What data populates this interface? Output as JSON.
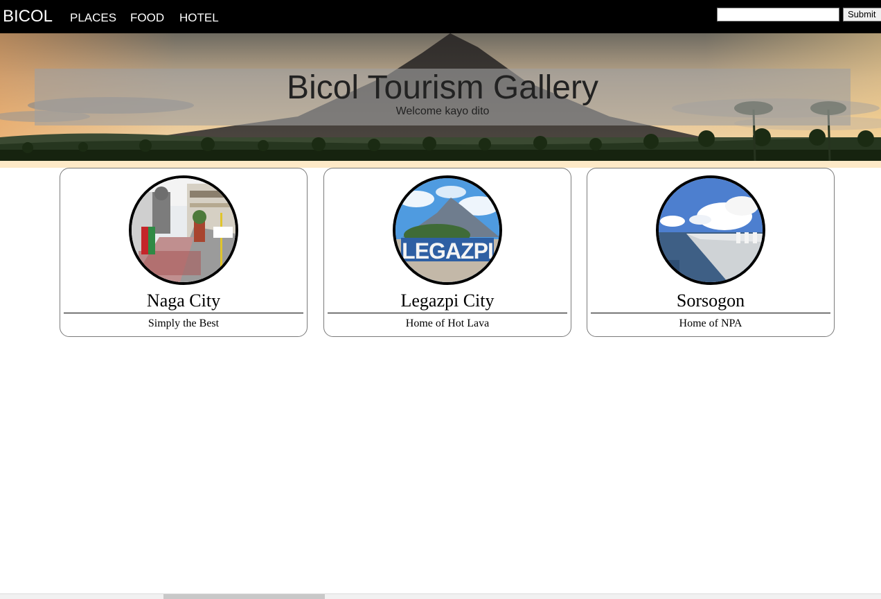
{
  "navbar": {
    "brand": "BICOL",
    "links": [
      "PLACES",
      "FOOD",
      "HOTEL"
    ],
    "search_value": "",
    "submit_label": "Submit"
  },
  "hero": {
    "title": "Bicol Tourism Gallery",
    "subtitle": "Welcome kayo dito"
  },
  "cards": [
    {
      "title": "Naga City",
      "subtitle": "Simply the Best",
      "photo": "street-photo"
    },
    {
      "title": "Legazpi City",
      "subtitle": "Home of Hot Lava",
      "photo": "volcano-sign-photo"
    },
    {
      "title": "Sorsogon",
      "subtitle": "Home of NPA",
      "photo": "seawall-photo"
    }
  ],
  "colors": {
    "navbar_bg": "#000000",
    "hero_strip": "#fde9c7",
    "card_border": "#7a7a7a"
  }
}
